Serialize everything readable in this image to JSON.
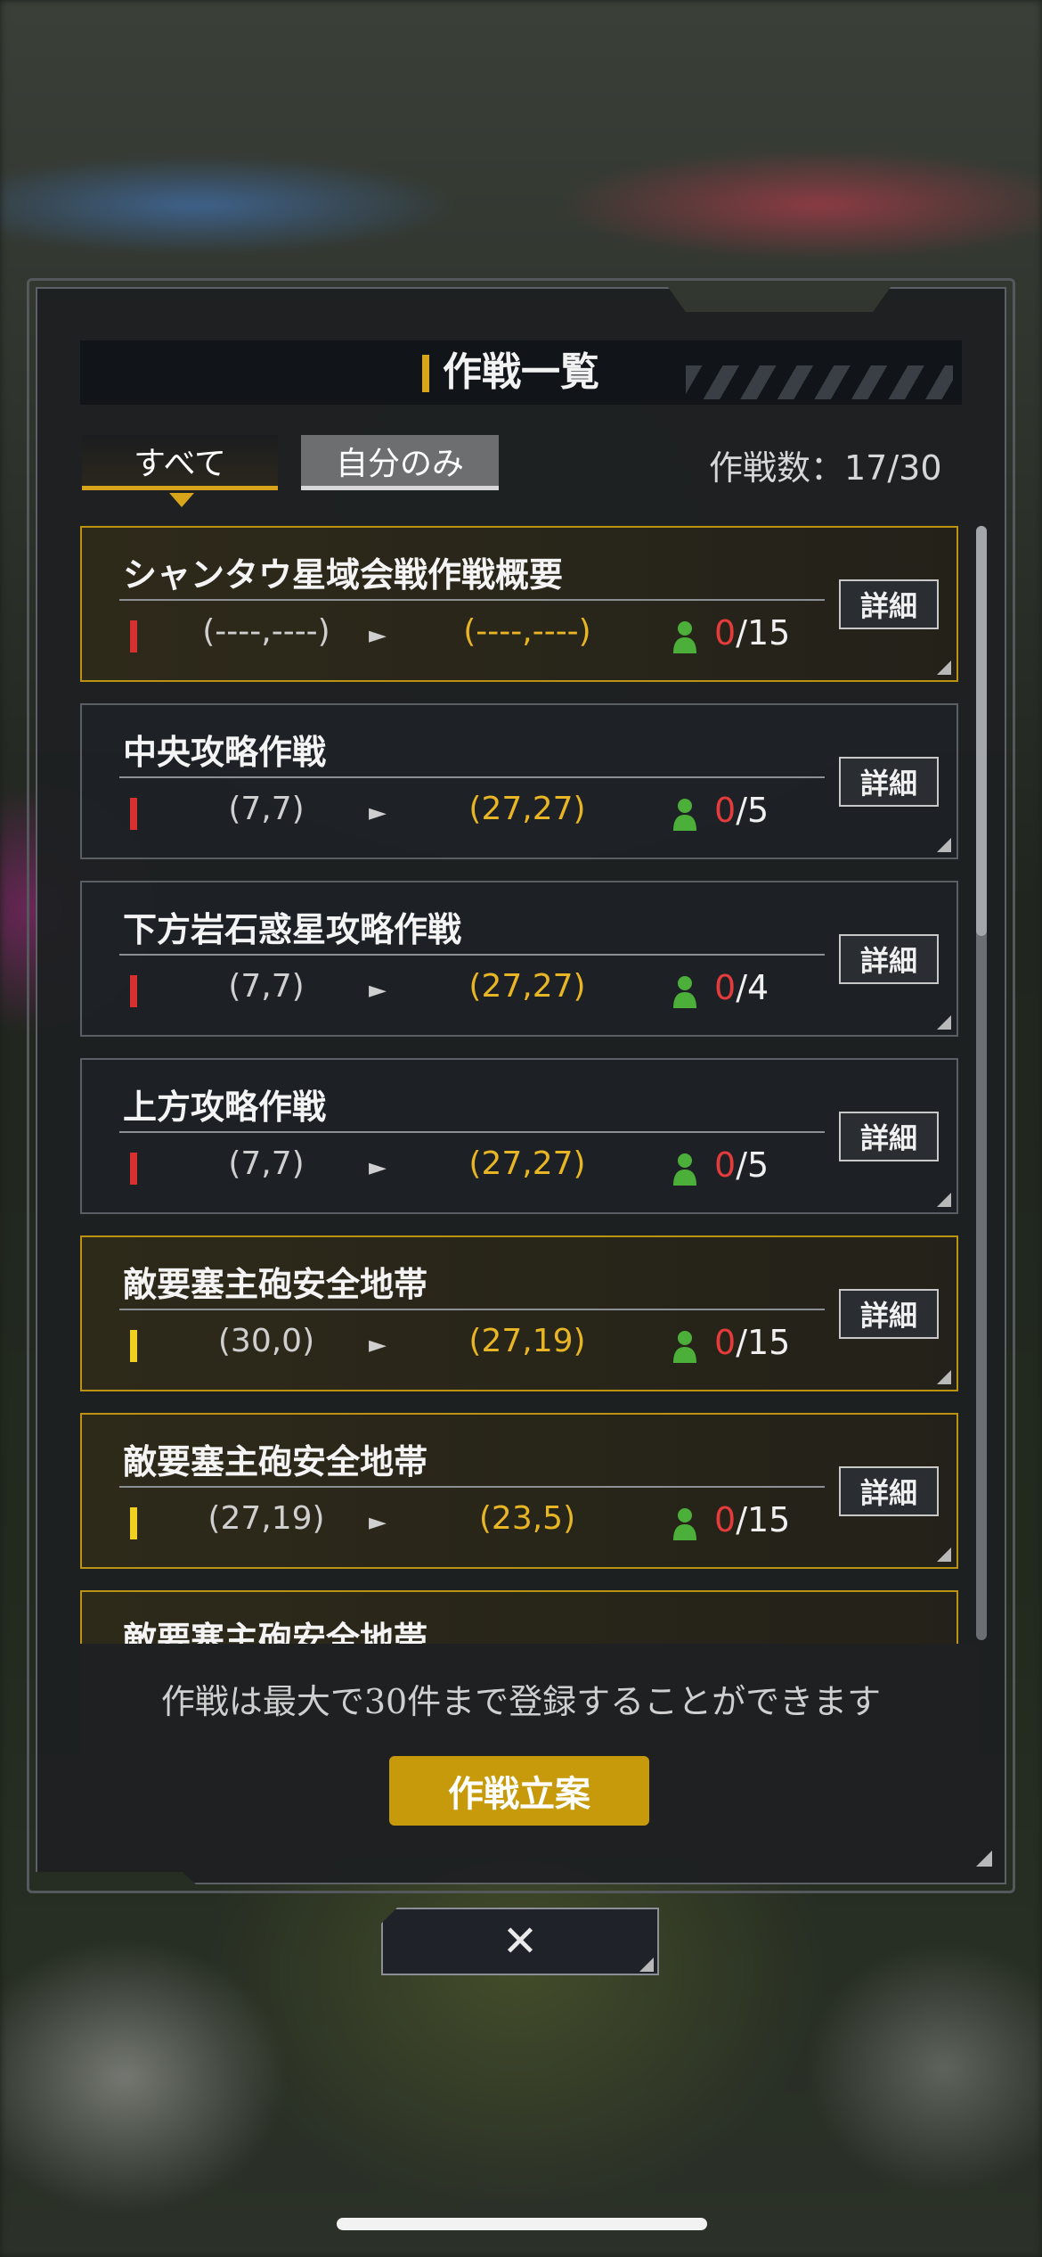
{
  "header": {
    "title": "作戦一覧"
  },
  "tabs": [
    {
      "label": "すべて",
      "selected": true
    },
    {
      "label": "自分のみ",
      "selected": false
    }
  ],
  "operation_count": "作戦数：17/30",
  "operations": [
    {
      "title": "シャンタウ星域会戦作戦概要",
      "mark": "red",
      "from": "(----,----)",
      "to": "(----,----)",
      "members": "0",
      "capacity": "/15",
      "detail_label": "詳細",
      "highlighted": true
    },
    {
      "title": "中央攻略作戦",
      "mark": "red",
      "from": "(7,7)",
      "to": "(27,27)",
      "members": "0",
      "capacity": "/5",
      "detail_label": "詳細",
      "highlighted": false
    },
    {
      "title": "下方岩石惑星攻略作戦",
      "mark": "red",
      "from": "(7,7)",
      "to": "(27,27)",
      "members": "0",
      "capacity": "/4",
      "detail_label": "詳細",
      "highlighted": false
    },
    {
      "title": "上方攻略作戦",
      "mark": "red",
      "from": "(7,7)",
      "to": "(27,27)",
      "members": "0",
      "capacity": "/5",
      "detail_label": "詳細",
      "highlighted": false
    },
    {
      "title": "敵要塞主砲安全地帯",
      "mark": "yellow",
      "from": "(30,0)",
      "to": "(27,19)",
      "members": "0",
      "capacity": "/15",
      "detail_label": "詳細",
      "highlighted": true
    },
    {
      "title": "敵要塞主砲安全地帯",
      "mark": "yellow",
      "from": "(27,19)",
      "to": "(23,5)",
      "members": "0",
      "capacity": "/15",
      "detail_label": "詳細",
      "highlighted": true
    },
    {
      "title": "敵要塞主砲安全地帯",
      "mark": "yellow",
      "from": "",
      "to": "",
      "members": "",
      "capacity": "",
      "detail_label": "",
      "highlighted": true
    }
  ],
  "footer": {
    "notice": "作戦は最大で30件まで登録することができます",
    "plan_button": "作戦立案"
  },
  "close_label": "✕",
  "colors": {
    "accent": "#d8a51a",
    "button_gold": "#c79a0c",
    "count_red": "#e53b3b",
    "coord_gold": "#e8b524",
    "member_green": "#4caf3a"
  }
}
